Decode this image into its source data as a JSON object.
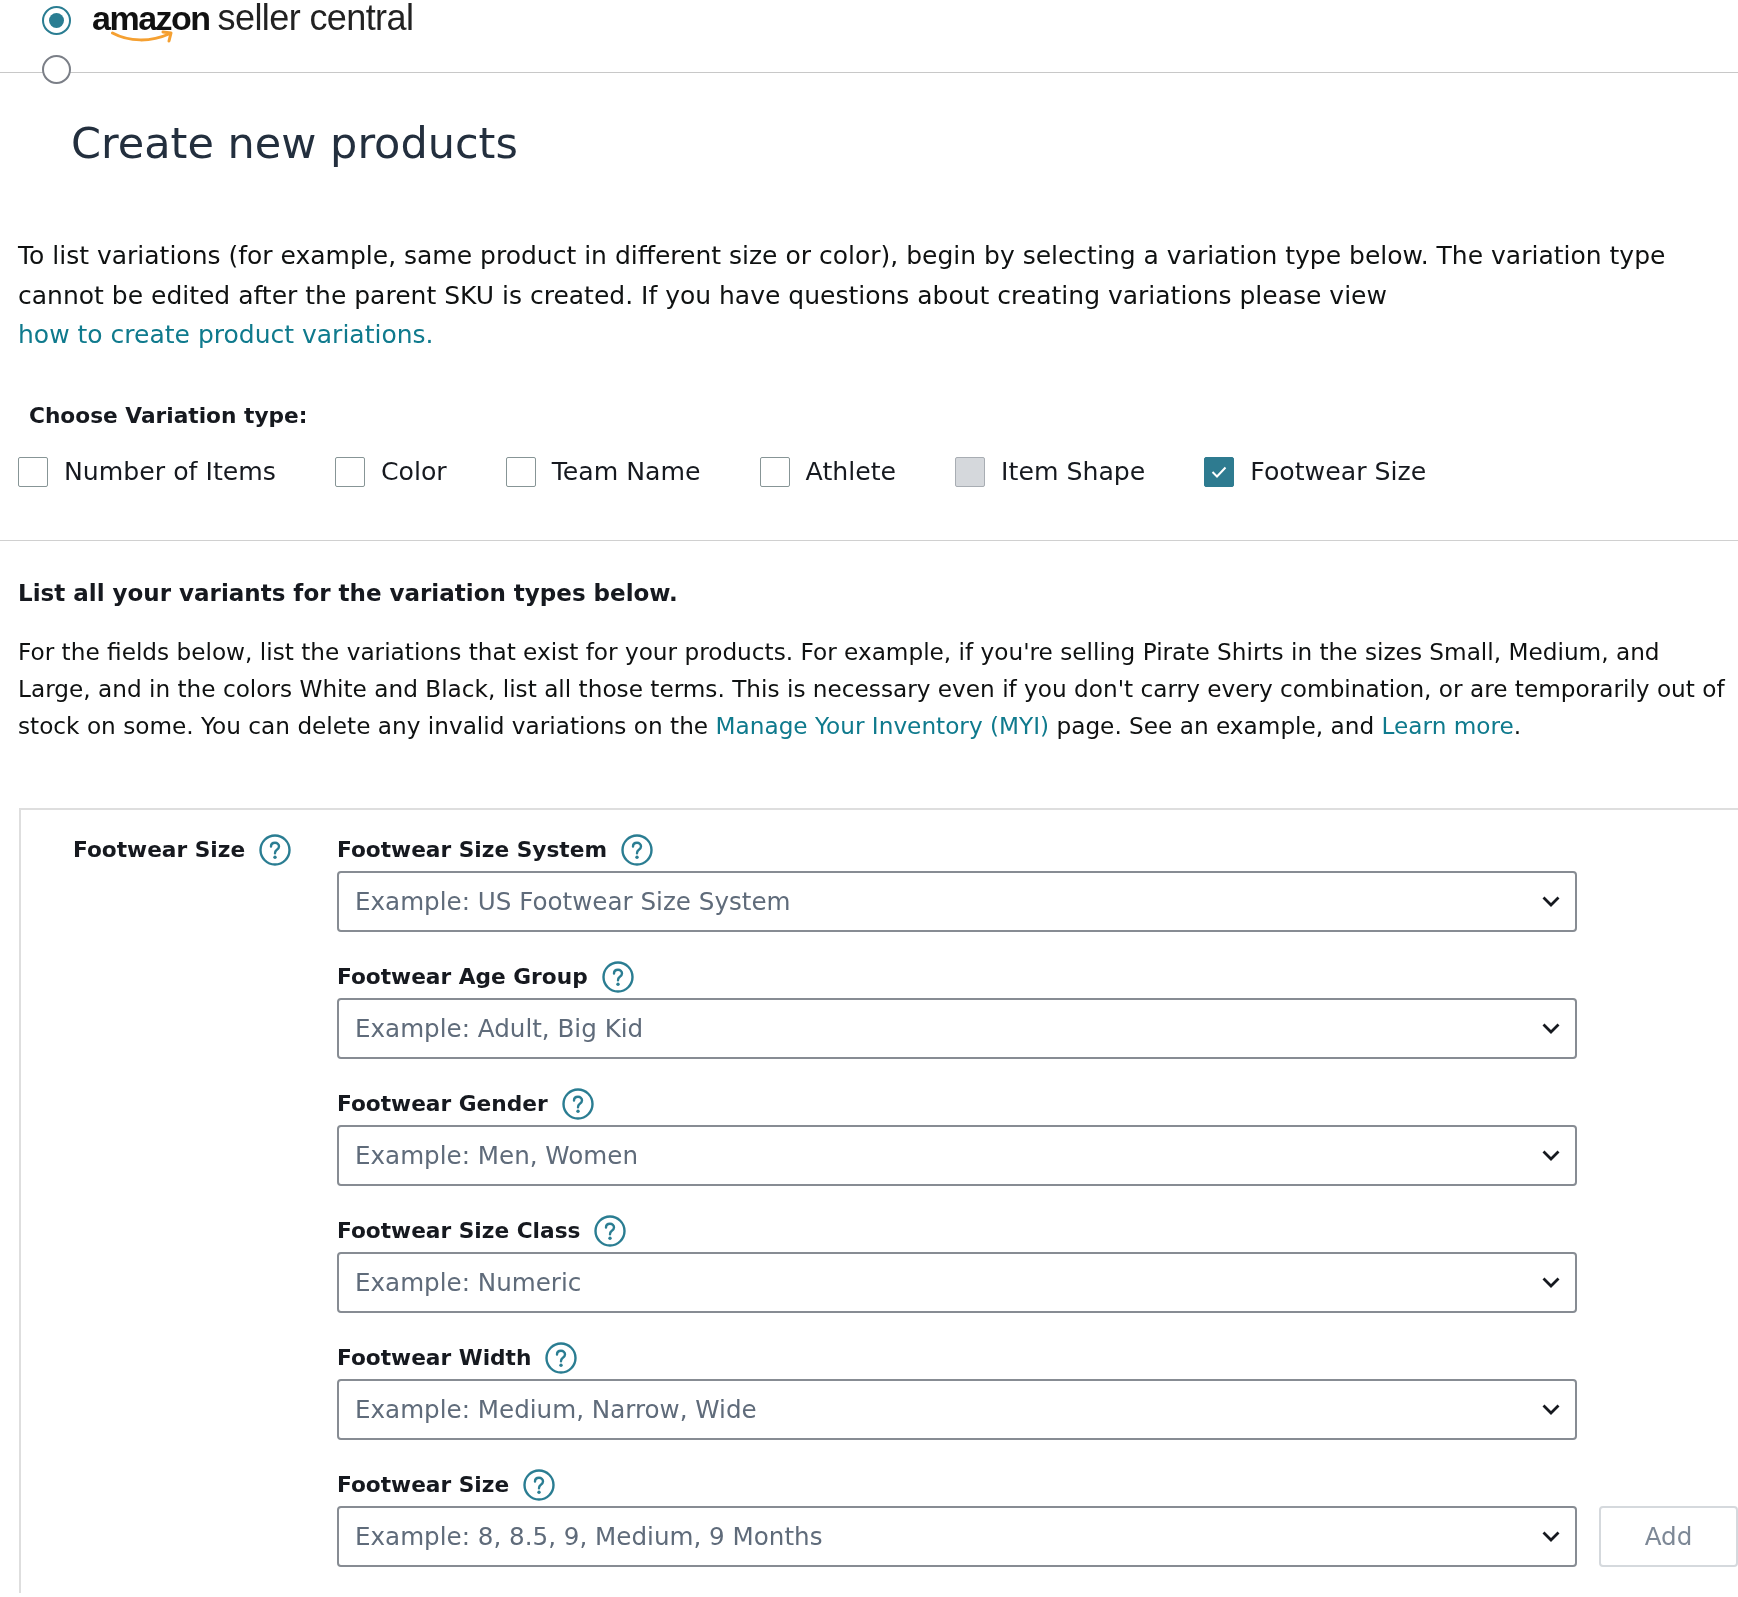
{
  "header": {
    "radios": [
      {
        "selected": true
      },
      {
        "selected": false
      }
    ],
    "logo": {
      "brand": "amazon",
      "product": "seller central"
    }
  },
  "page_title": "Create new products",
  "intro": {
    "text": "To list variations (for example, same product in different size or color), begin by selecting a variation type below. The variation type cannot be edited after the parent SKU is created. If you have questions about creating variations please view ",
    "link": "how to create product variations."
  },
  "variation_types": {
    "heading": "Choose Variation type:",
    "options": [
      {
        "label": "Number of Items",
        "checked": false,
        "disabled": false
      },
      {
        "label": "Color",
        "checked": false,
        "disabled": false
      },
      {
        "label": "Team Name",
        "checked": false,
        "disabled": false
      },
      {
        "label": "Athlete",
        "checked": false,
        "disabled": false
      },
      {
        "label": "Item Shape",
        "checked": false,
        "disabled": true
      },
      {
        "label": "Footwear Size",
        "checked": true,
        "disabled": false
      }
    ]
  },
  "variants": {
    "heading": "List all your variants for the variation types below.",
    "description": [
      {
        "kind": "text",
        "text": "For the fields below, list the variations that exist for your products. For example, if you're selling Pirate Shirts in the sizes Small, Medium, and Large, and in the colors White and Black, list all those terms. This is necessary even if you don't carry every combination, or are temporarily out of stock on some. You can delete any invalid variations on the "
      },
      {
        "kind": "link",
        "text": "Manage Your Inventory (MYI)"
      },
      {
        "kind": "text",
        "text": " page. See an example, and "
      },
      {
        "kind": "link",
        "text": "Learn more"
      },
      {
        "kind": "text",
        "text": "."
      }
    ]
  },
  "panel": {
    "title": "Footwear Size",
    "fields": [
      {
        "label": "Footwear Size System",
        "placeholder": "Example: US Footwear Size System"
      },
      {
        "label": "Footwear Age Group",
        "placeholder": "Example: Adult, Big Kid"
      },
      {
        "label": "Footwear Gender",
        "placeholder": "Example: Men, Women"
      },
      {
        "label": "Footwear Size Class",
        "placeholder": "Example: Numeric"
      },
      {
        "label": "Footwear Width",
        "placeholder": "Example: Medium, Narrow, Wide"
      },
      {
        "label": "Footwear Size",
        "placeholder": "Example: 8, 8.5, 9, Medium, 9 Months",
        "add_button": {
          "label": "Add",
          "disabled": true
        }
      }
    ]
  }
}
